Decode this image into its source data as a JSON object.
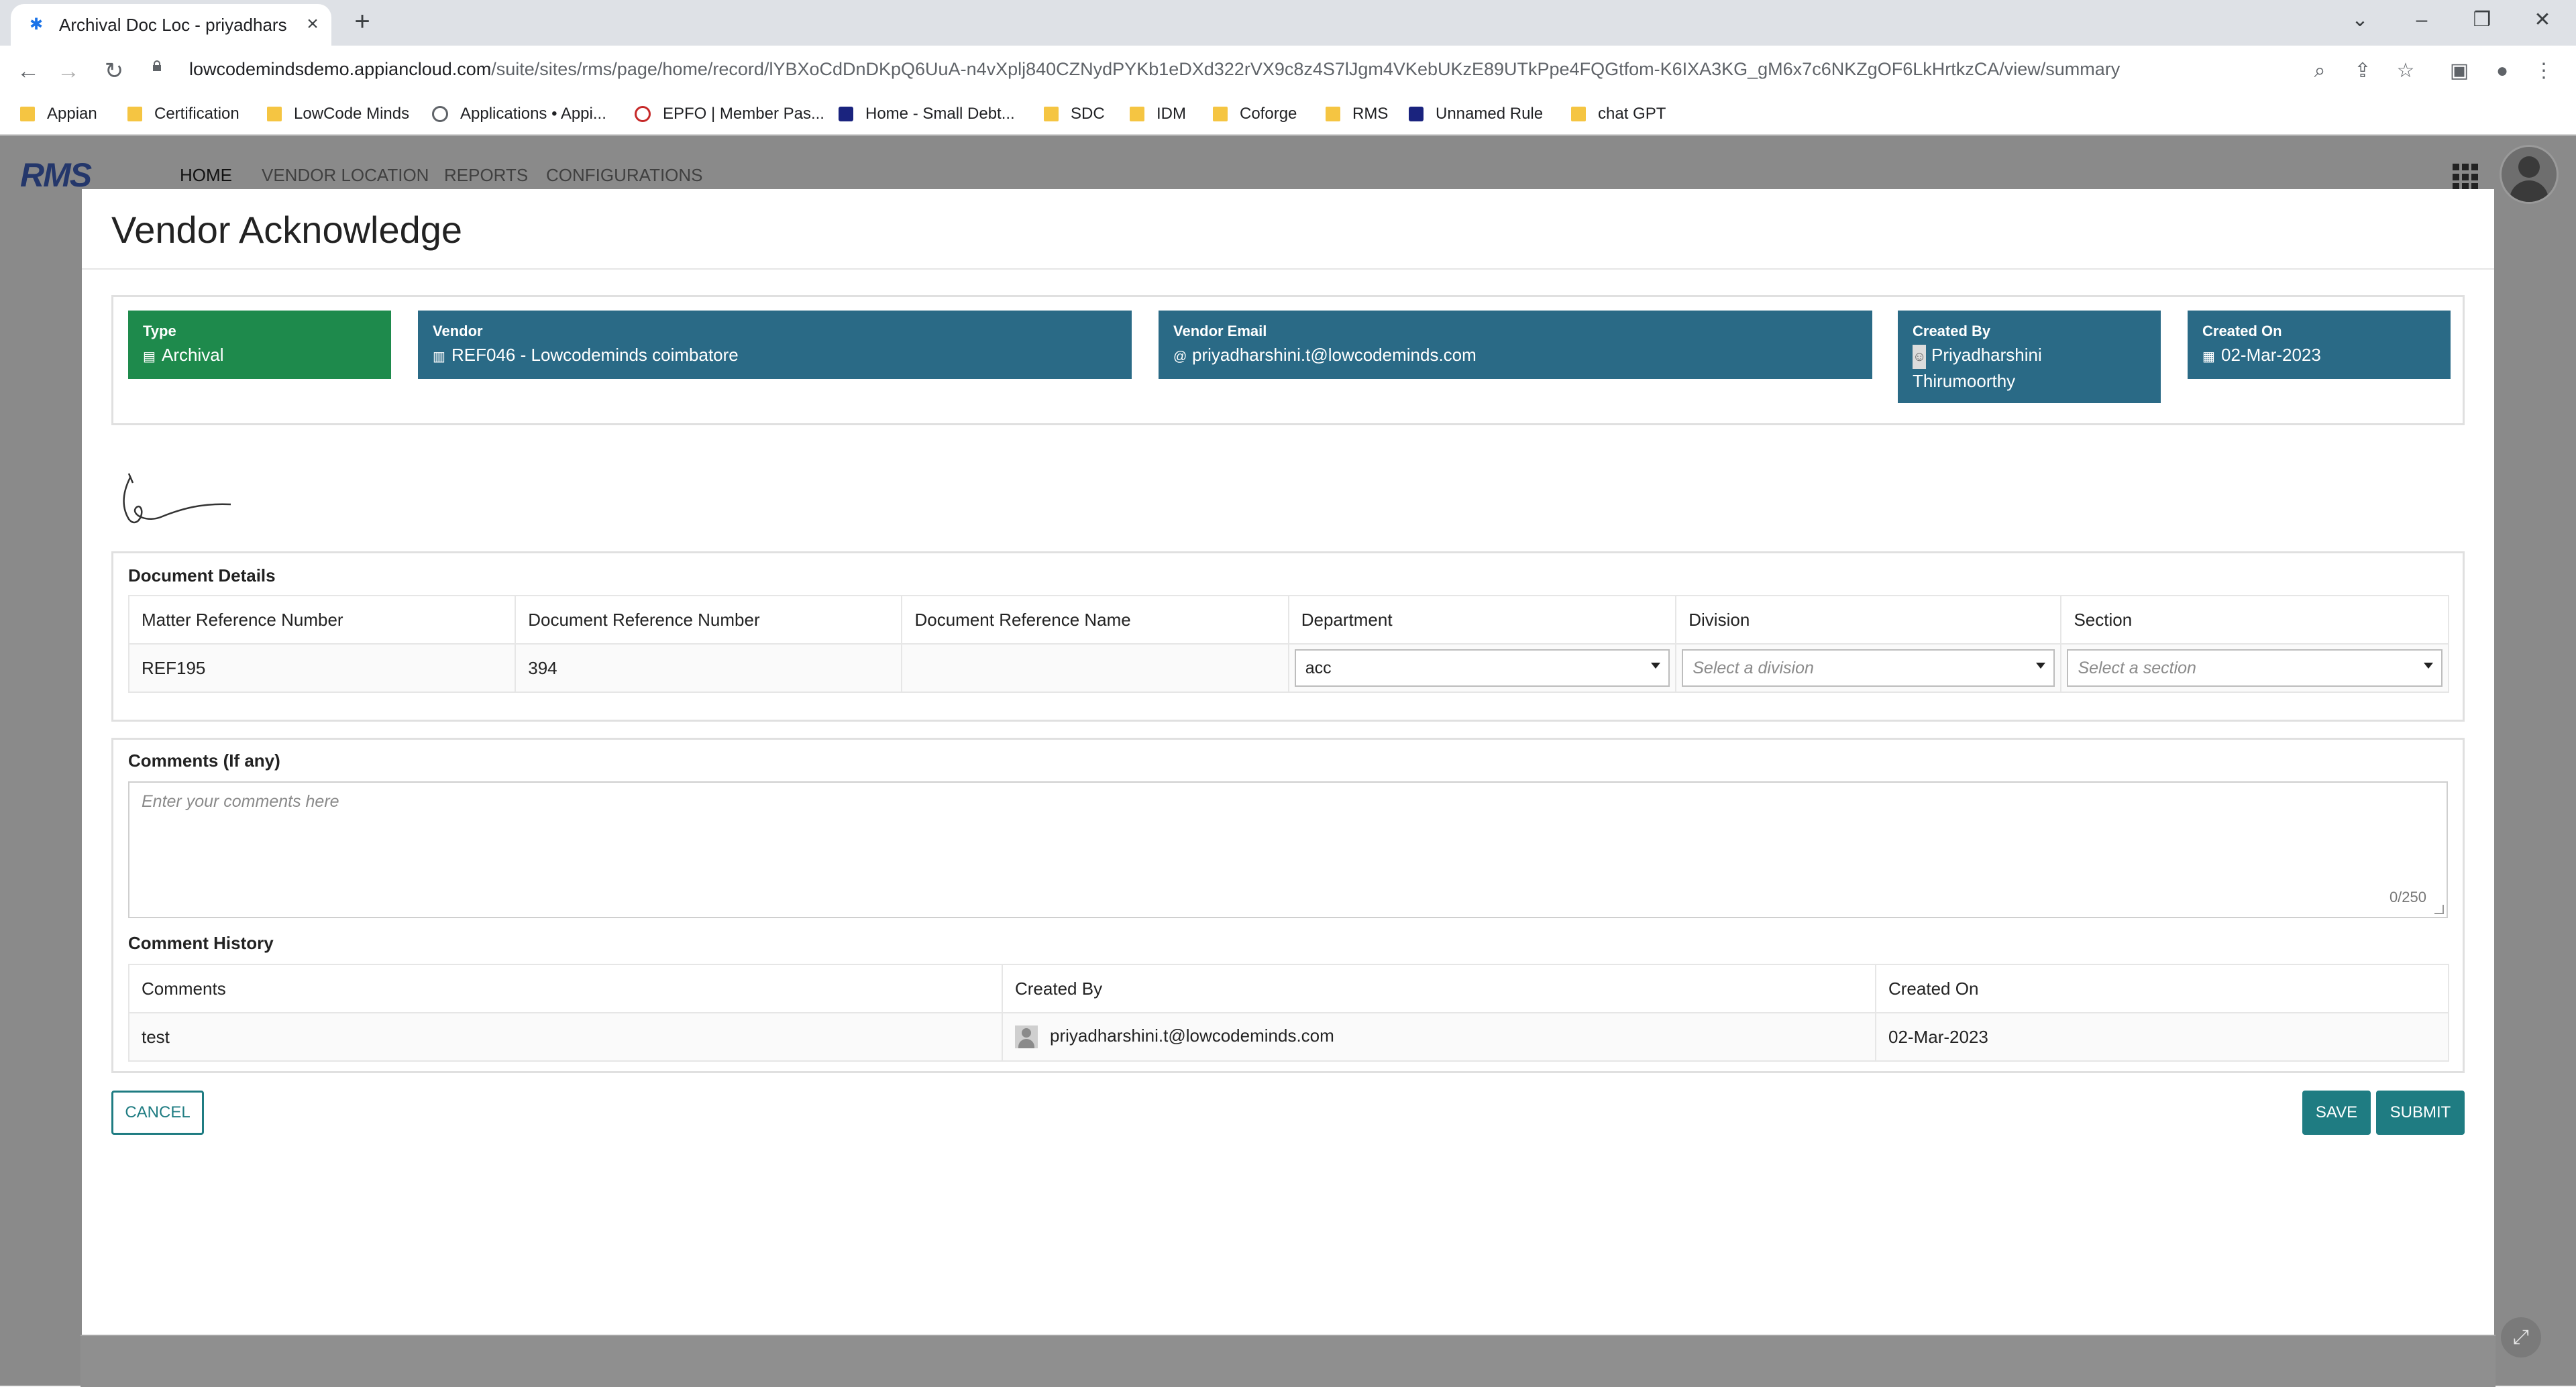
{
  "browser": {
    "tab_title": "Archival Doc Loc - priyadharshini",
    "url_host": "lowcodemindsdemo.appiancloud.com",
    "url_path": "/suite/sites/rms/page/home/record/lYBXoCdDnDKpQ6UuA-n4vXplj840CZNydPYKb1eDXd322rVX9c8z4S7lJgm4VKebUKzE89UTkPpe4FQGtfom-K6IXA3KG_gM6x7c6NKZgOF6LkHrtkzCA/view/summary",
    "bookmarks": [
      {
        "label": "Appian",
        "icon": "folder-icon"
      },
      {
        "label": "Certification",
        "icon": "folder-icon"
      },
      {
        "label": "LowCode Minds",
        "icon": "folder-icon"
      },
      {
        "label": "Applications • Appi...",
        "icon": "globe-icon"
      },
      {
        "label": "EPFO | Member Pas...",
        "icon": "epfo-icon"
      },
      {
        "label": "Home - Small Debt...",
        "icon": "site-icon"
      },
      {
        "label": "SDC",
        "icon": "folder-icon"
      },
      {
        "label": "IDM",
        "icon": "folder-icon"
      },
      {
        "label": "Coforge",
        "icon": "folder-icon"
      },
      {
        "label": "RMS",
        "icon": "folder-icon"
      },
      {
        "label": "Unnamed Rule",
        "icon": "site-icon"
      },
      {
        "label": "chat GPT",
        "icon": "folder-icon"
      }
    ]
  },
  "app": {
    "logo": "RMS",
    "nav": [
      "HOME",
      "VENDOR LOCATION",
      "REPORTS",
      "CONFIGURATIONS"
    ]
  },
  "modal": {
    "title": "Vendor Acknowledge",
    "cards": {
      "type": {
        "label": "Type",
        "value": "Archival",
        "color": "#1e8a4c"
      },
      "vendor": {
        "label": "Vendor",
        "value": "REF046 - Lowcodeminds coimbatore",
        "color": "#2a6a86"
      },
      "vendor_email": {
        "label": "Vendor Email",
        "value": "priyadharshini.t@lowcodeminds.com",
        "color": "#2a6a86"
      },
      "created_by": {
        "label": "Created By",
        "value_line1": "Priyadharshini",
        "value_line2": "Thirumoorthy",
        "color": "#2a6a86"
      },
      "created_on": {
        "label": "Created On",
        "value": "02-Mar-2023",
        "color": "#2a6a86"
      }
    },
    "document_details": {
      "heading": "Document Details",
      "columns": [
        "Matter Reference Number",
        "Document Reference Number",
        "Document Reference Name",
        "Department",
        "Division",
        "Section"
      ],
      "row": {
        "matter_ref": "REF195",
        "doc_ref_number": "394",
        "doc_ref_name": "",
        "department": "acc",
        "division_placeholder": "Select a division",
        "section_placeholder": "Select a section"
      }
    },
    "comments": {
      "heading": "Comments (If any)",
      "placeholder": "Enter your comments here",
      "counter": "0/250"
    },
    "comment_history": {
      "heading": "Comment History",
      "columns": [
        "Comments",
        "Created By",
        "Created On"
      ],
      "rows": [
        {
          "comment": "test",
          "created_by": "priyadharshini.t@lowcodeminds.com",
          "created_on": "02-Mar-2023"
        }
      ]
    },
    "buttons": {
      "cancel": "CANCEL",
      "save": "SAVE",
      "submit": "SUBMIT"
    },
    "accent_color": "#1f7c82"
  }
}
